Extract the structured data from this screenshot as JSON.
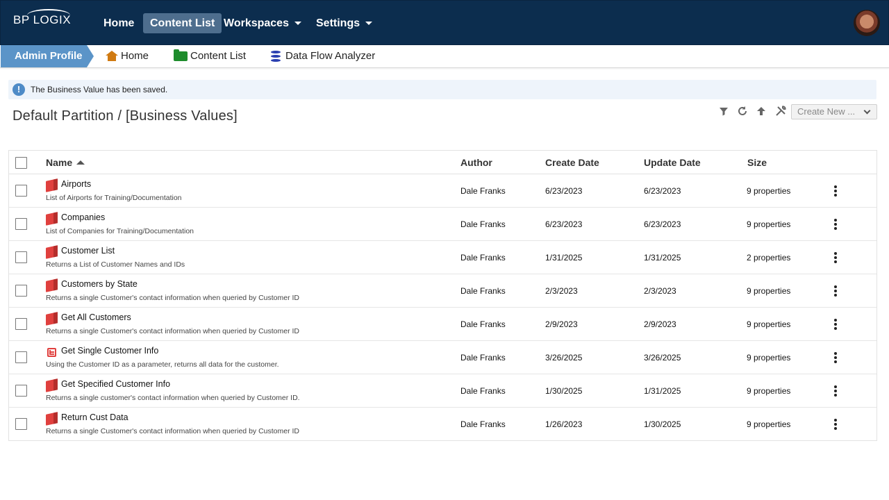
{
  "header": {
    "logo_text": "BP LOGIX",
    "nav": [
      {
        "label": "Home",
        "active": false
      },
      {
        "label": "Content List",
        "active": true
      },
      {
        "label": "Workspaces",
        "dropdown": true
      },
      {
        "label": "Settings",
        "dropdown": true
      }
    ]
  },
  "breadcrumb": {
    "active": "Admin Profile",
    "items": [
      {
        "label": "Home",
        "icon": "home-icon"
      },
      {
        "label": "Content List",
        "icon": "folder-icon"
      },
      {
        "label": "Data Flow Analyzer",
        "icon": "database-icon"
      }
    ]
  },
  "banner": {
    "message": "The Business Value has been saved.",
    "icon": "info-icon",
    "color": "#4e8bc7"
  },
  "page": {
    "title": "Default Partition / [Business Values]"
  },
  "toolbar": {
    "icons": [
      "filter-icon",
      "refresh-icon",
      "up-arrow-icon",
      "tools-icon"
    ],
    "create_new_label": "Create New ..."
  },
  "table": {
    "columns": {
      "name": "Name",
      "author": "Author",
      "create_date": "Create Date",
      "update_date": "Update Date",
      "size": "Size"
    },
    "sort": {
      "column": "Name",
      "direction": "ascending"
    },
    "rows": [
      {
        "name": "Airports",
        "desc": "List of Airports for Training/Documentation",
        "author": "Dale Franks",
        "create": "6/23/2023",
        "update": "6/23/2023",
        "size": "9 properties",
        "icon": "business-value-icon"
      },
      {
        "name": "Companies",
        "desc": "List of Companies for Training/Documentation",
        "author": "Dale Franks",
        "create": "6/23/2023",
        "update": "6/23/2023",
        "size": "9 properties",
        "icon": "business-value-icon"
      },
      {
        "name": "Customer List",
        "desc": "Returns a List of Customer Names and IDs",
        "author": "Dale Franks",
        "create": "1/31/2025",
        "update": "1/31/2025",
        "size": "2 properties",
        "icon": "business-value-icon"
      },
      {
        "name": "Customers by State",
        "desc": "Returns a single Customer's contact information when queried by Customer ID",
        "author": "Dale Franks",
        "create": "2/3/2023",
        "update": "2/3/2023",
        "size": "9 properties",
        "icon": "business-value-icon"
      },
      {
        "name": "Get All Customers",
        "desc": "Returns a single Customer's contact information when queried by Customer ID",
        "author": "Dale Franks",
        "create": "2/9/2023",
        "update": "2/9/2023",
        "size": "9 properties",
        "icon": "business-value-icon"
      },
      {
        "name": "Get Single Customer Info",
        "desc": "Using the Customer ID as a parameter, returns all data for the customer.",
        "author": "Dale Franks",
        "create": "3/26/2025",
        "update": "3/26/2025",
        "size": "9 properties",
        "icon": "table-icon"
      },
      {
        "name": "Get Specified Customer Info",
        "desc": "Returns a single customer's contact information when queried by Customer ID.",
        "author": "Dale Franks",
        "create": "1/30/2025",
        "update": "1/31/2025",
        "size": "9 properties",
        "icon": "business-value-icon"
      },
      {
        "name": "Return Cust Data",
        "desc": "Returns a single Customer's contact information when queried by Customer ID",
        "author": "Dale Franks",
        "create": "1/26/2023",
        "update": "1/30/2025",
        "size": "9 properties",
        "icon": "business-value-icon"
      }
    ]
  }
}
